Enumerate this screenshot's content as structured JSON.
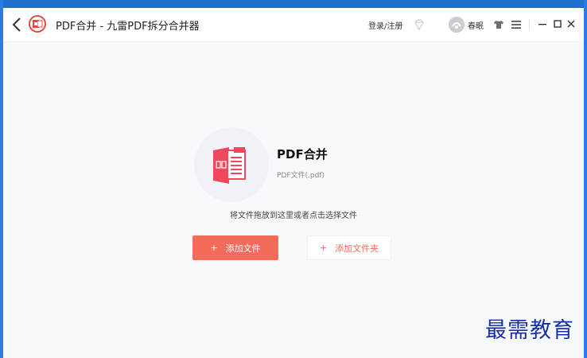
{
  "window": {
    "title": "PDF合并 - 九雷PDF拆分合并器"
  },
  "header": {
    "login_label": "登录/注册",
    "username": "春眠",
    "icons": {
      "back": "chevron-left-icon",
      "logo": "pdf-logo-icon",
      "vip": "diamond-icon",
      "skin": "tshirt-icon",
      "menu": "hamburger-menu-icon",
      "minimize": "minimize-icon",
      "maximize": "maximize-icon",
      "close": "close-icon"
    }
  },
  "main": {
    "feature_title": "PDF合并",
    "feature_subtitle": "PDF文件(.pdf)",
    "hint": "将文件拖放到这里或者点击选择文件",
    "add_file_label": "添加文件",
    "add_folder_label": "添加文件夹",
    "plus_symbol": "+"
  },
  "watermark": "最需教育",
  "colors": {
    "accent": "#f26b5b",
    "desktop": "#1f6fd0",
    "watermark": "#1a2ea8"
  }
}
